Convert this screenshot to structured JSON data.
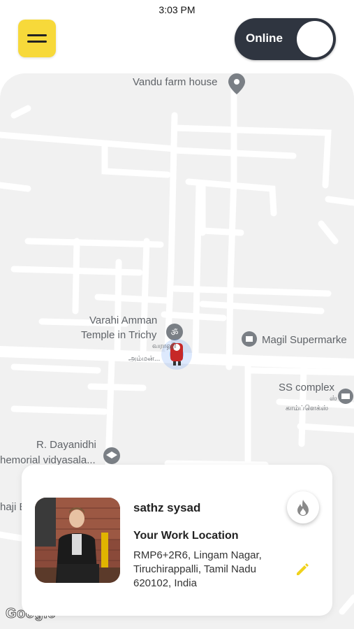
{
  "status_bar": {
    "time": "3:03 PM"
  },
  "header": {
    "menu_icon": "hamburger-icon",
    "status_toggle": {
      "label": "Online",
      "state": "on"
    }
  },
  "map": {
    "places": {
      "farm_house": "Vandu farm house",
      "temple_line1": "Varahi Amman",
      "temple_line2": "Temple in Trichy",
      "temple_tamil1": "வராஹி",
      "temple_tamil2": "அம்மன்...",
      "supermarket": "Magil Supermarke",
      "ss_complex": "SS complex",
      "ss_tamil1": "ஸ்",
      "ss_tamil2": "காம்ப்ளெக்ஸ்",
      "school_line1": "R. Dayanidhi",
      "school_line2": "hemorial vidyasala...",
      "edge_label": "haji E"
    },
    "attribution": "Google"
  },
  "driver_card": {
    "name": "sathz sysad",
    "location_title": "Your Work Location",
    "address_lines": [
      "RMP6+2R6, Lingam Nagar,",
      "Tiruchirappalli, Tamil Nadu",
      "620102, India"
    ],
    "colors": {
      "accent_yellow": "#f7d93a",
      "toggle_dark": "#2f3540"
    }
  }
}
